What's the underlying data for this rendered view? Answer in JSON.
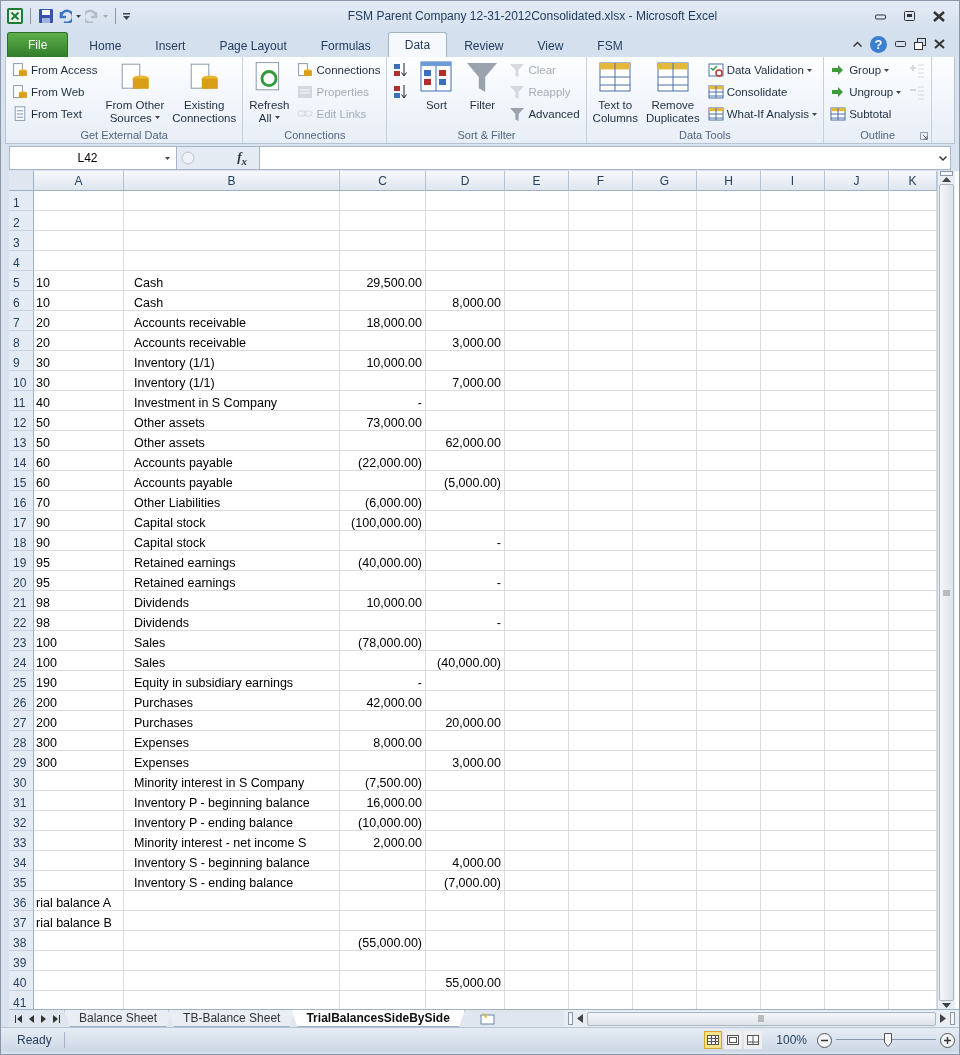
{
  "window": {
    "title": "FSM Parent Company 12-31-2012Consolidated.xlsx  -  Microsoft Excel"
  },
  "ribbon_tabs": [
    {
      "label": "File",
      "kind": "file",
      "selected": false
    },
    {
      "label": "Home",
      "kind": "tab",
      "selected": false
    },
    {
      "label": "Insert",
      "kind": "tab",
      "selected": false
    },
    {
      "label": "Page Layout",
      "kind": "tab",
      "selected": false
    },
    {
      "label": "Formulas",
      "kind": "tab",
      "selected": false
    },
    {
      "label": "Data",
      "kind": "tab",
      "selected": true
    },
    {
      "label": "Review",
      "kind": "tab",
      "selected": false
    },
    {
      "label": "View",
      "kind": "tab",
      "selected": false
    },
    {
      "label": "FSM",
      "kind": "tab",
      "selected": false
    }
  ],
  "help": "?",
  "ribbon_groups": [
    {
      "label": "Get External Data",
      "launcher": false,
      "items": [
        {
          "label": "From Access",
          "kind": "small",
          "disabled": false,
          "dropdown": false
        },
        {
          "label": "From Web",
          "kind": "small",
          "disabled": false,
          "dropdown": false
        },
        {
          "label": "From Text",
          "kind": "small",
          "disabled": false,
          "dropdown": false
        },
        {
          "label": "From Other\nSources",
          "kind": "large",
          "disabled": false,
          "dropdown": true
        },
        {
          "label": "Existing\nConnections",
          "kind": "large",
          "disabled": false,
          "dropdown": false
        }
      ]
    },
    {
      "label": "Connections",
      "launcher": false,
      "items": [
        {
          "label": "Refresh\nAll",
          "kind": "large",
          "disabled": false,
          "dropdown": true
        },
        {
          "label": "Connections",
          "kind": "small",
          "disabled": false,
          "dropdown": false
        },
        {
          "label": "Properties",
          "kind": "small",
          "disabled": true,
          "dropdown": false
        },
        {
          "label": "Edit Links",
          "kind": "small",
          "disabled": true,
          "dropdown": false
        }
      ]
    },
    {
      "label": "Sort & Filter",
      "launcher": false,
      "items": [
        {
          "kind": "icon",
          "disabled": false,
          "dropdown": false
        },
        {
          "kind": "icon",
          "disabled": false,
          "dropdown": false
        },
        {
          "label": "Sort",
          "kind": "large",
          "disabled": false,
          "dropdown": false
        },
        {
          "label": "Filter",
          "kind": "large",
          "disabled": false,
          "dropdown": false
        },
        {
          "label": "Clear",
          "kind": "small",
          "disabled": true,
          "dropdown": false
        },
        {
          "label": "Reapply",
          "kind": "small",
          "disabled": true,
          "dropdown": false
        },
        {
          "label": "Advanced",
          "kind": "small",
          "disabled": false,
          "dropdown": false
        }
      ]
    },
    {
      "label": "Data Tools",
      "launcher": false,
      "items": [
        {
          "label": "Text to\nColumns",
          "kind": "large",
          "disabled": false,
          "dropdown": false
        },
        {
          "label": "Remove\nDuplicates",
          "kind": "large",
          "disabled": false,
          "dropdown": false
        },
        {
          "label": "Data Validation",
          "kind": "small",
          "disabled": false,
          "dropdown": true
        },
        {
          "label": "Consolidate",
          "kind": "small",
          "disabled": false,
          "dropdown": false
        },
        {
          "label": "What-If Analysis",
          "kind": "small",
          "disabled": false,
          "dropdown": true
        }
      ]
    },
    {
      "label": "Outline",
      "launcher": true,
      "items": [
        {
          "label": "Group",
          "kind": "small",
          "disabled": false,
          "dropdown": true
        },
        {
          "label": "Ungroup",
          "kind": "small",
          "disabled": false,
          "dropdown": true
        },
        {
          "label": "Subtotal",
          "kind": "small",
          "disabled": false,
          "dropdown": false
        },
        {
          "kind": "icon",
          "disabled": true,
          "dropdown": false
        },
        {
          "kind": "icon",
          "disabled": true,
          "dropdown": false
        }
      ]
    }
  ],
  "formula_bar": {
    "name_box": "L42",
    "function_label": "f$_{x}$"
  },
  "sheet": {
    "columns": [
      "A",
      "B",
      "C",
      "D",
      "E",
      "F",
      "G",
      "H",
      "I",
      "J",
      "K"
    ],
    "rows": [
      {
        "number": "1"
      },
      {
        "number": "2"
      },
      {
        "number": "3"
      },
      {
        "number": "4"
      },
      {
        "number": "5",
        "a": "10",
        "b": "Cash",
        "c": "29,500.00"
      },
      {
        "number": "6",
        "a": "10",
        "b": "Cash",
        "d": "8,000.00"
      },
      {
        "number": "7",
        "a": "20",
        "b": "Accounts receivable",
        "c": "18,000.00"
      },
      {
        "number": "8",
        "a": "20",
        "b": "Accounts receivable",
        "d": "3,000.00"
      },
      {
        "number": "9",
        "a": "30",
        "b": "Inventory (1/1)",
        "c": "10,000.00"
      },
      {
        "number": "10",
        "a": "30",
        "b": "Inventory (1/1)",
        "d": "7,000.00"
      },
      {
        "number": "11",
        "a": "40",
        "b": "Investment in S Company",
        "c": "-"
      },
      {
        "number": "12",
        "a": "50",
        "b": "Other assets",
        "c": "73,000.00"
      },
      {
        "number": "13",
        "a": "50",
        "b": "Other assets",
        "d": "62,000.00"
      },
      {
        "number": "14",
        "a": "60",
        "b": "Accounts payable",
        "c": "(22,000.00)"
      },
      {
        "number": "15",
        "a": "60",
        "b": "Accounts payable",
        "d": "(5,000.00)"
      },
      {
        "number": "16",
        "a": "70",
        "b": "Other Liabilities",
        "c": "(6,000.00)"
      },
      {
        "number": "17",
        "a": "90",
        "b": "Capital stock",
        "c": "(100,000.00)"
      },
      {
        "number": "18",
        "a": "90",
        "b": "Capital stock",
        "d": "-"
      },
      {
        "number": "19",
        "a": "95",
        "b": "Retained earnings",
        "c": "(40,000.00)"
      },
      {
        "number": "20",
        "a": "95",
        "b": "Retained earnings",
        "d": "-"
      },
      {
        "number": "21",
        "a": "98",
        "b": "Dividends",
        "c": "10,000.00"
      },
      {
        "number": "22",
        "a": "98",
        "b": "Dividends",
        "d": "-"
      },
      {
        "number": "23",
        "a": "100",
        "b": "Sales",
        "c": "(78,000.00)"
      },
      {
        "number": "24",
        "a": "100",
        "b": "Sales",
        "d": "(40,000.00)"
      },
      {
        "number": "25",
        "a": "190",
        "b": "Equity in subsidiary earnings",
        "c": "-"
      },
      {
        "number": "26",
        "a": "200",
        "b": "Purchases",
        "c": "42,000.00"
      },
      {
        "number": "27",
        "a": "200",
        "b": "Purchases",
        "d": "20,000.00"
      },
      {
        "number": "28",
        "a": "300",
        "b": "Expenses",
        "c": "8,000.00"
      },
      {
        "number": "29",
        "a": "300",
        "b": "Expenses",
        "d": "3,000.00"
      },
      {
        "number": "30",
        "b": "Minority interest in S Company",
        "c": "(7,500.00)"
      },
      {
        "number": "31",
        "b": "Inventory P - beginning balance",
        "c": "16,000.00"
      },
      {
        "number": "32",
        "b": "Inventory P - ending balance",
        "c": "(10,000.00)"
      },
      {
        "number": "33",
        "b": "Minority interest - net income S",
        "c": "2,000.00"
      },
      {
        "number": "34",
        "b": "Inventory S - beginning balance",
        "d": "4,000.00"
      },
      {
        "number": "35",
        "b": "Inventory S - ending balance",
        "d": "(7,000.00)"
      },
      {
        "number": "36",
        "a": "rial balance A"
      },
      {
        "number": "37",
        "a": "rial balance B"
      },
      {
        "number": "38",
        "c": "(55,000.00)"
      },
      {
        "number": "39"
      },
      {
        "number": "40",
        "d": "55,000.00"
      },
      {
        "number": "41"
      }
    ]
  },
  "sheet_tabs": [
    {
      "label": "Balance Sheet",
      "selected": false
    },
    {
      "label": "TB-Balance Sheet",
      "selected": false
    },
    {
      "label": "TrialBalancesSideBySide",
      "selected": true
    }
  ],
  "status_bar": {
    "status": "Ready",
    "views": [
      {
        "selected": true
      },
      {
        "selected": false
      },
      {
        "selected": false
      }
    ],
    "zoom": "100%",
    "zoom_slider": {
      "level": 0.52
    }
  }
}
